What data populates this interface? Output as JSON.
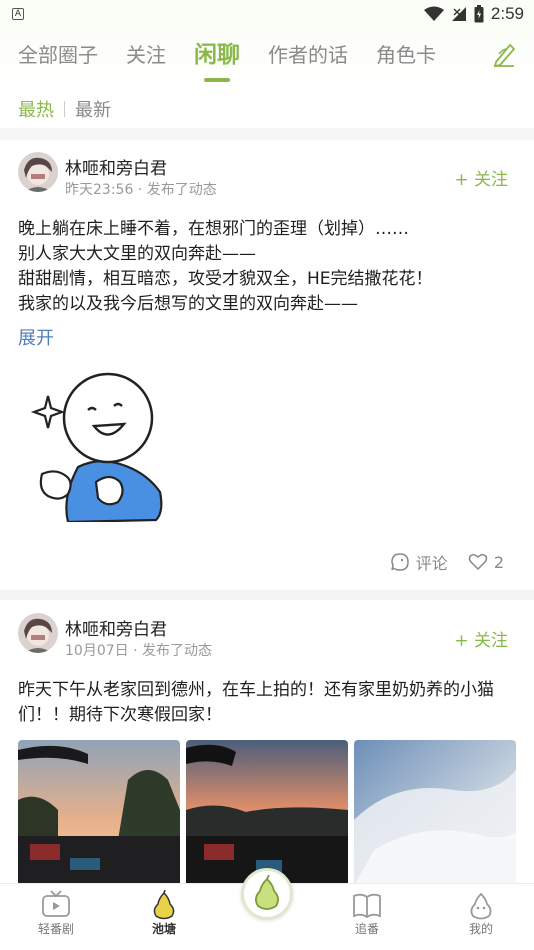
{
  "status_bar": {
    "time": "2:59",
    "left_badge": "A"
  },
  "top_tabs": [
    {
      "label": "全部圈子",
      "active": false
    },
    {
      "label": "关注",
      "active": false
    },
    {
      "label": "闲聊",
      "active": true
    },
    {
      "label": "作者的话",
      "active": false
    },
    {
      "label": "角色卡",
      "active": false
    }
  ],
  "sort": {
    "hot": "最热",
    "new": "最新",
    "selected": "hot"
  },
  "posts": [
    {
      "author": "林咂和旁白君",
      "meta": "昨天23:56 · 发布了动态",
      "follow": "+ 关注",
      "lines": [
        "晚上躺在床上睡不着，在想邪门的歪理（划掉）……",
        "别人家大大文里的双向奔赴——",
        "甜甜剧情，相互暗恋，攻受才貌双全，HE完结撒花花！",
        "我家的以及我今后想写的文里的双向奔赴——"
      ],
      "expand": "展开",
      "comment": "评论",
      "likes": "2"
    },
    {
      "author": "林咂和旁白君",
      "meta": "10月07日 · 发布了动态",
      "follow": "+ 关注",
      "lines": [
        "昨天下午从老家回到德州，在车上拍的！还有家里奶奶养的小猫",
        "们！！期待下次寒假回家！"
      ]
    }
  ],
  "bottom_nav": [
    {
      "label": "轻番剧",
      "icon": "tv-icon",
      "active": false
    },
    {
      "label": "池塘",
      "icon": "pear-icon",
      "active": true
    },
    {
      "label": "追番",
      "icon": "book-icon",
      "active": false
    },
    {
      "label": "我的",
      "icon": "profile-pear-icon",
      "active": false
    }
  ],
  "colors": {
    "accent": "#8bb84a",
    "link": "#4f7fb7",
    "muted": "#9a9a9a"
  }
}
